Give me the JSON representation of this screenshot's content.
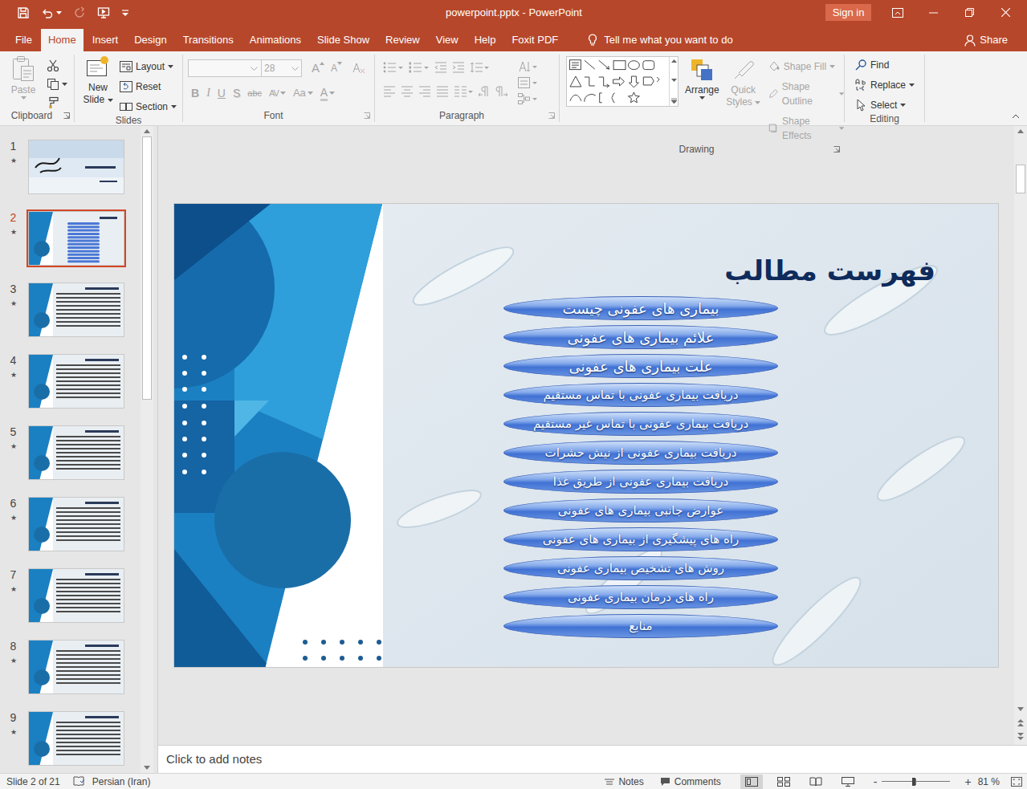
{
  "window": {
    "title": "powerpoint.pptx - PowerPoint",
    "sign_in": "Sign in"
  },
  "tabs": [
    {
      "label": "File",
      "selected": false
    },
    {
      "label": "Home",
      "selected": true
    },
    {
      "label": "Insert",
      "selected": false
    },
    {
      "label": "Design",
      "selected": false
    },
    {
      "label": "Transitions",
      "selected": false
    },
    {
      "label": "Animations",
      "selected": false
    },
    {
      "label": "Slide Show",
      "selected": false
    },
    {
      "label": "Review",
      "selected": false
    },
    {
      "label": "View",
      "selected": false
    },
    {
      "label": "Help",
      "selected": false
    },
    {
      "label": "Foxit PDF",
      "selected": false
    }
  ],
  "tell_me": "Tell me what you want to do",
  "share": "Share",
  "ribbon": {
    "clipboard": {
      "label": "Clipboard",
      "paste": {
        "label": "Paste",
        "disabled": true
      }
    },
    "slides": {
      "label": "Slides",
      "new_slide": "New Slide",
      "layout": "Layout",
      "reset": "Reset",
      "section": "Section"
    },
    "font": {
      "label": "Font",
      "disabled": true,
      "size": "28",
      "grow": "A",
      "shrink": "A",
      "buttons": [
        "B",
        "I",
        "U",
        "S",
        "abc",
        "AV",
        "Aa",
        "A"
      ]
    },
    "paragraph": {
      "label": "Paragraph",
      "disabled": true
    },
    "drawing": {
      "label": "Drawing",
      "arrange": "Arrange",
      "quick_styles": {
        "label": "Quick Styles",
        "disabled": true
      },
      "shape_fill": {
        "label": "Shape Fill",
        "disabled": true
      },
      "shape_outline": {
        "label": "Shape Outline",
        "disabled": true
      },
      "shape_effects": {
        "label": "Shape Effects",
        "disabled": true
      }
    },
    "editing": {
      "label": "Editing",
      "find": "Find",
      "replace": "Replace",
      "select": "Select"
    }
  },
  "thumbnails": [
    {
      "number": "1",
      "mark": "★",
      "kind": "title",
      "selected": false
    },
    {
      "number": "2",
      "mark": "★",
      "kind": "toc",
      "selected": true
    },
    {
      "number": "3",
      "mark": "★",
      "kind": "content",
      "selected": false
    },
    {
      "number": "4",
      "mark": "★",
      "kind": "content",
      "selected": false
    },
    {
      "number": "5",
      "mark": "★",
      "kind": "content",
      "selected": false
    },
    {
      "number": "6",
      "mark": "★",
      "kind": "content",
      "selected": false
    },
    {
      "number": "7",
      "mark": "★",
      "kind": "content",
      "selected": false
    },
    {
      "number": "8",
      "mark": "★",
      "kind": "content",
      "selected": false
    },
    {
      "number": "9",
      "mark": "★",
      "kind": "content",
      "selected": false
    }
  ],
  "thumbnail_scroll": {
    "offset": 0,
    "size": 0.42
  },
  "slide_scroll": {
    "offset": 0.05,
    "size": 0.05
  },
  "slide": {
    "title": "فهرست مطالب",
    "items": [
      "بیماری های عفونی چیست",
      "علائم بیماری های عفونی",
      "علت بیماری های عفونی",
      "دریافت بیماری عفونی با تماس مستقیم",
      "دریافت بیماری عفونی با تماس غیر مستقیم",
      "دریافت بیماری عفونی از نیش حشرات",
      "دریافت بیماری عفونی از طریق غذا",
      "عوارض جانبی بیماری های عفونی",
      "راه های پیشگیری از بیماری های عفونی",
      "روش های تشخیص بیماری عفونی",
      "راه های درمان بیماری عفونی",
      "منابع"
    ]
  },
  "notes": {
    "placeholder": "Click to add notes"
  },
  "status_bar": {
    "slide": "Slide 2 of 21",
    "language": "Persian (Iran)",
    "notes": "Notes",
    "comments": "Comments",
    "views": [
      {
        "selected": true
      },
      {
        "selected": false
      },
      {
        "selected": false
      },
      {
        "selected": false
      }
    ],
    "zoom_out": "-",
    "zoom_in": "+",
    "zoom_level": 0.47,
    "zoom": "81 %"
  }
}
